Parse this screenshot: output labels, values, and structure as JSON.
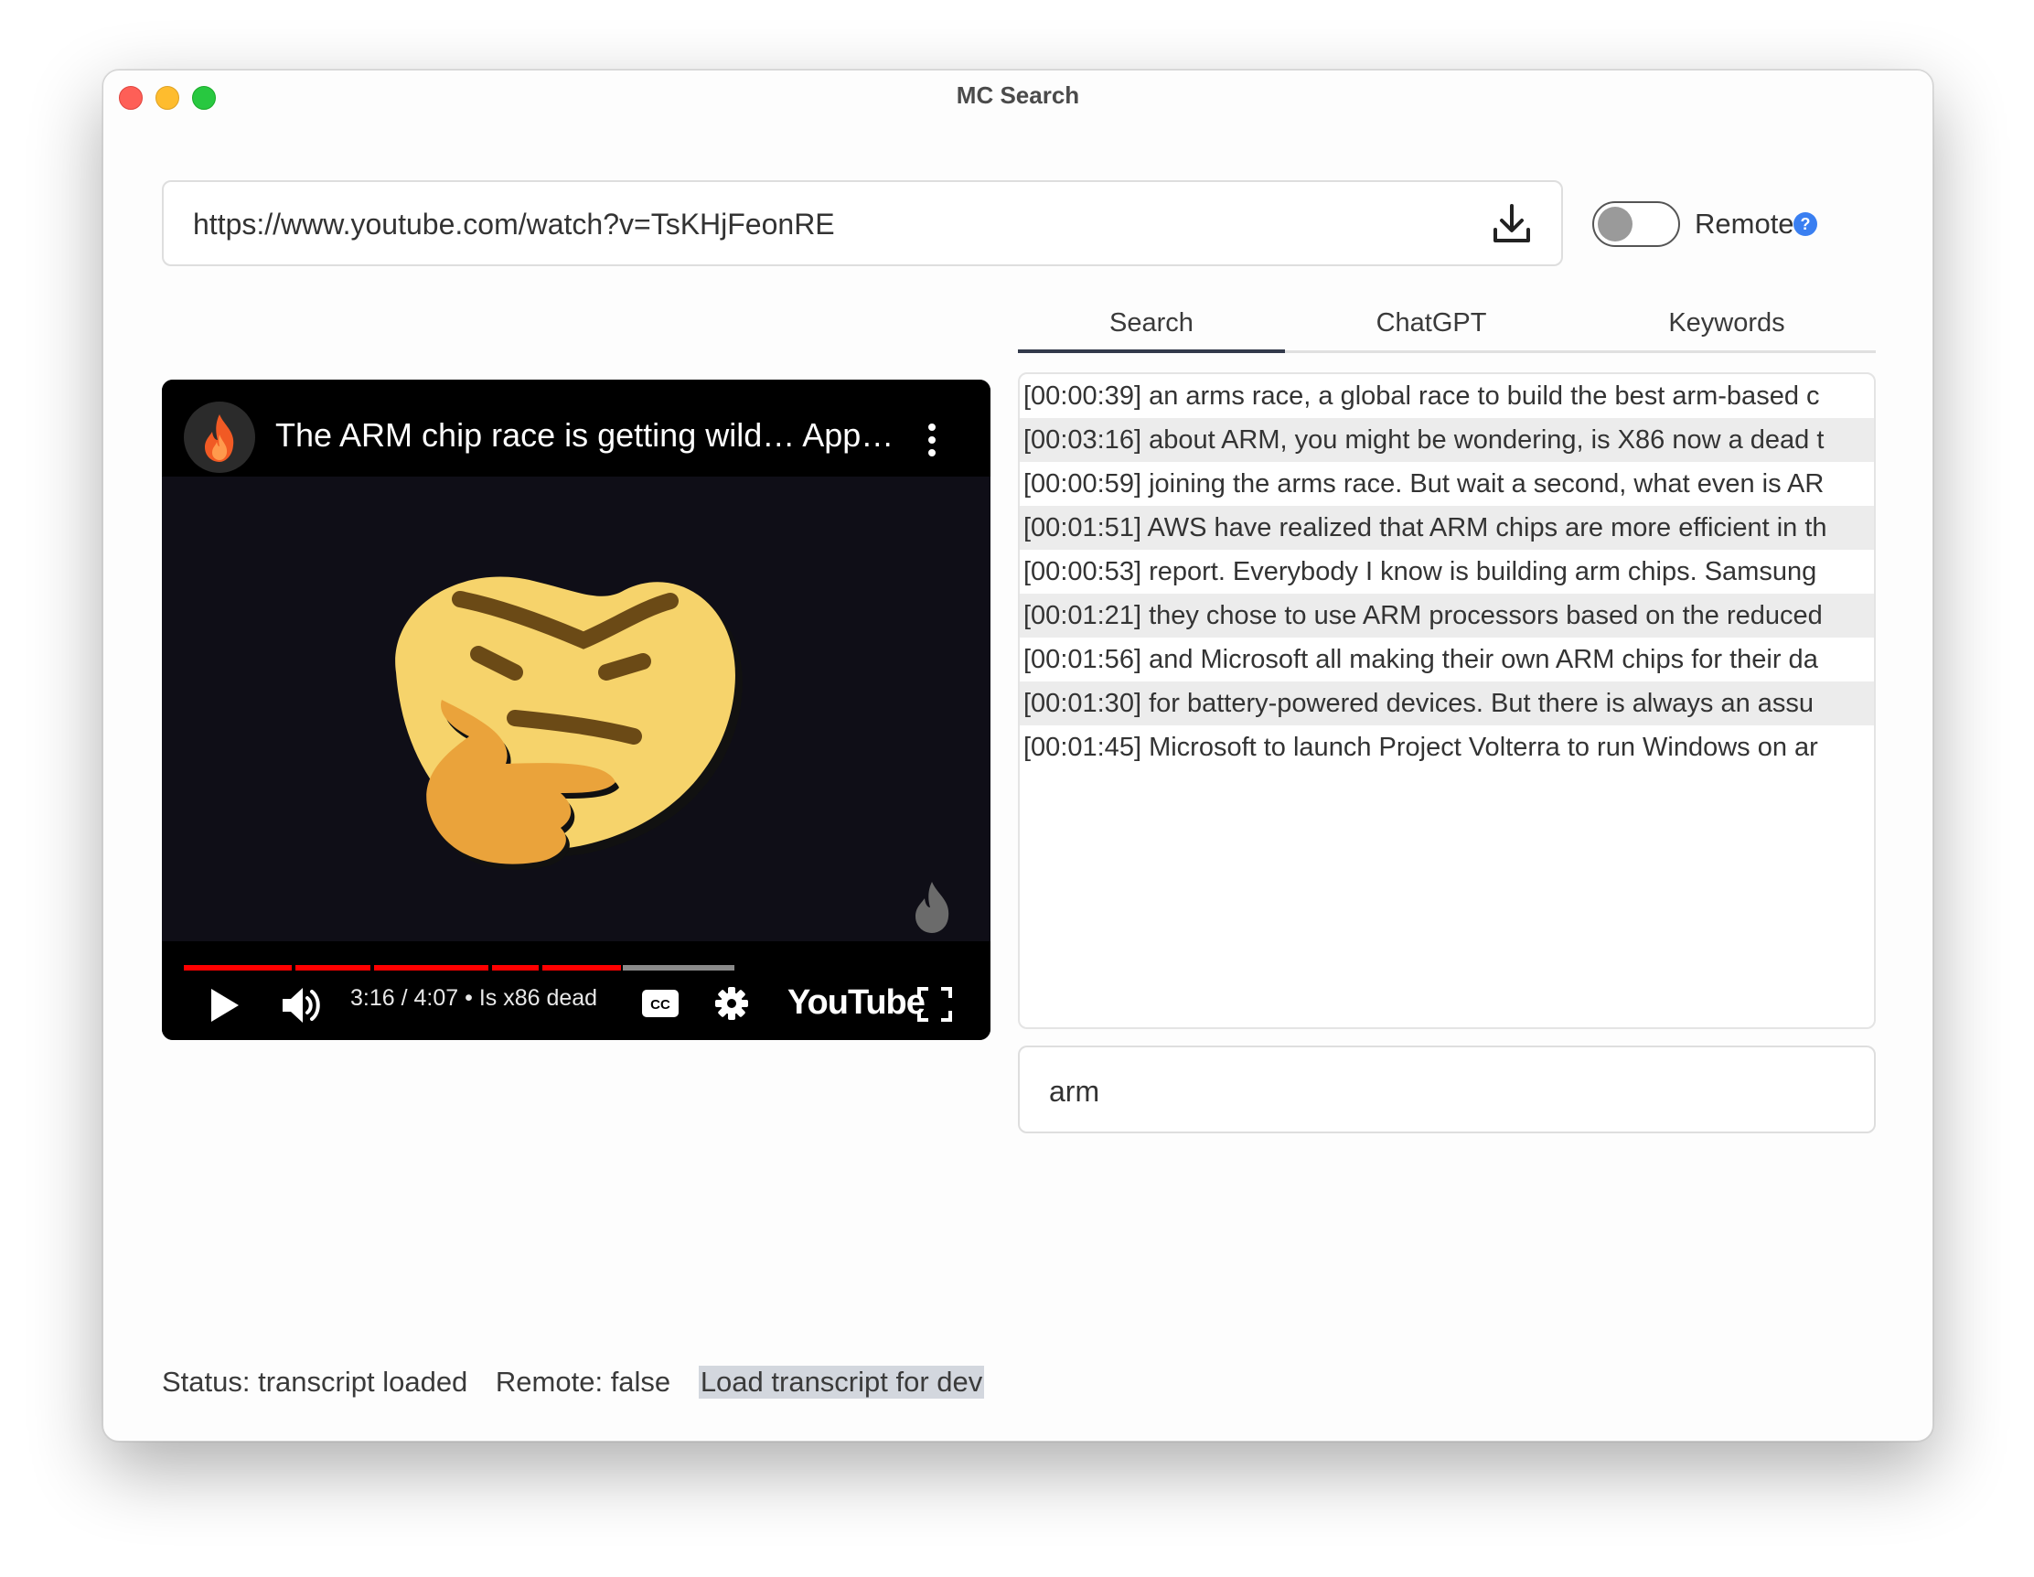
{
  "window": {
    "title": "MC Search"
  },
  "url_input": {
    "value": "https://www.youtube.com/watch?v=TsKHjFeonRE"
  },
  "remote_toggle": {
    "label": "Remote",
    "on": false,
    "help": "?"
  },
  "tabs": [
    {
      "label": "Search",
      "active": true
    },
    {
      "label": "ChatGPT",
      "active": false
    },
    {
      "label": "Keywords",
      "active": false
    }
  ],
  "results": [
    {
      "time": "[00:00:39]",
      "text": "an arms race, a global race to build the best arm-based c"
    },
    {
      "time": "[00:03:16]",
      "text": "about ARM, you might be wondering, is X86 now a dead t"
    },
    {
      "time": "[00:00:59]",
      "text": "joining the arms race. But wait a second, what even is AR"
    },
    {
      "time": "[00:01:51]",
      "text": "AWS have realized that ARM chips are more efficient in th"
    },
    {
      "time": "[00:00:53]",
      "text": "report. Everybody I know is building arm chips. Samsung"
    },
    {
      "time": "[00:01:21]",
      "text": "they chose to use ARM processors based on the reduced"
    },
    {
      "time": "[00:01:56]",
      "text": "and Microsoft all making their own ARM chips for their da"
    },
    {
      "time": "[00:01:30]",
      "text": "for battery-powered devices. But there is always an assu"
    },
    {
      "time": "[00:01:45]",
      "text": "Microsoft to launch Project Volterra to run Windows on ar"
    }
  ],
  "query_input": {
    "value": "arm"
  },
  "player": {
    "video_title": "The ARM chip race is getting wild… App…",
    "time_display": "3:16 / 4:07",
    "chapter": "Is x86 dead",
    "progress_fraction": 0.79,
    "brand": "YouTube"
  },
  "status": {
    "status_text": "Status: transcript loaded",
    "remote_text": "Remote: false",
    "dev_button": "Load transcript for dev"
  },
  "colors": {
    "accent": "#3a7ff1",
    "progress_played": "#ff0000",
    "progress_rest": "#8a8a8a",
    "row_alt": "#ececec"
  }
}
